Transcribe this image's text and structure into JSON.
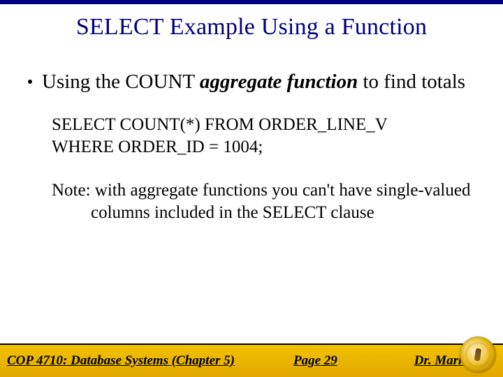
{
  "title": "SELECT Example Using a Function",
  "bullet": {
    "prefix": "Using the COUNT ",
    "emph": "aggregate function",
    "suffix": " to find totals"
  },
  "code": {
    "line1": "SELECT COUNT(*) FROM ORDER_LINE_V",
    "line2": "WHERE ORDER_ID = 1004;"
  },
  "note": "Note: with aggregate functions you can't have single-valued columns included in the SELECT clause",
  "footer": {
    "course": "COP 4710: Database Systems  (Chapter 5)",
    "page": "Page 29",
    "author": "Dr. Mark"
  }
}
